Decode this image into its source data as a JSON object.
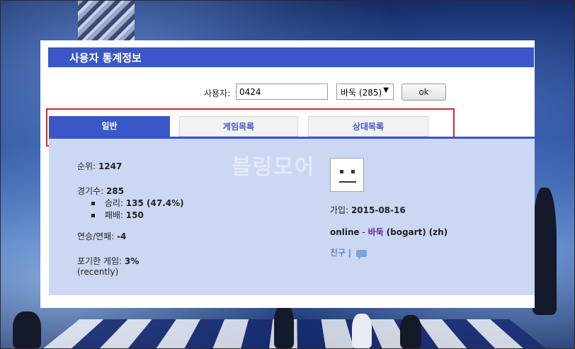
{
  "header": {
    "title": "사용자 통계정보"
  },
  "search": {
    "label": "사용자:",
    "value": "0424",
    "game_selected": "바둑 (285)",
    "ok_label": "ok"
  },
  "tabs": [
    {
      "label": "일반",
      "active": true
    },
    {
      "label": "게임목록",
      "active": false
    },
    {
      "label": "상대목록",
      "active": false
    }
  ],
  "stats": {
    "rank_label": "순위:",
    "rank_value": "1247",
    "games_label": "경기수:",
    "games_value": "285",
    "wins_label": "승리:",
    "wins_value": "135 (47.4%)",
    "losses_label": "패배:",
    "losses_value": "150",
    "streak_label": "연승/연패:",
    "streak_value": "-4",
    "abandon_label": "포기한 게임:",
    "abandon_value": "3%",
    "abandon_note": "(recently)"
  },
  "profile": {
    "join_label": "가입:",
    "join_date": "2015-08-16",
    "status": "online",
    "separator": "-",
    "game": "바둑",
    "nickname": "(bogart)",
    "lang": "(zh)",
    "friend_label": "친구",
    "pipe": "|"
  },
  "watermark": "블링모어",
  "colors": {
    "accent": "#3a57c8",
    "content_bg": "#ccd7f3",
    "highlight_border": "#d9262e"
  }
}
